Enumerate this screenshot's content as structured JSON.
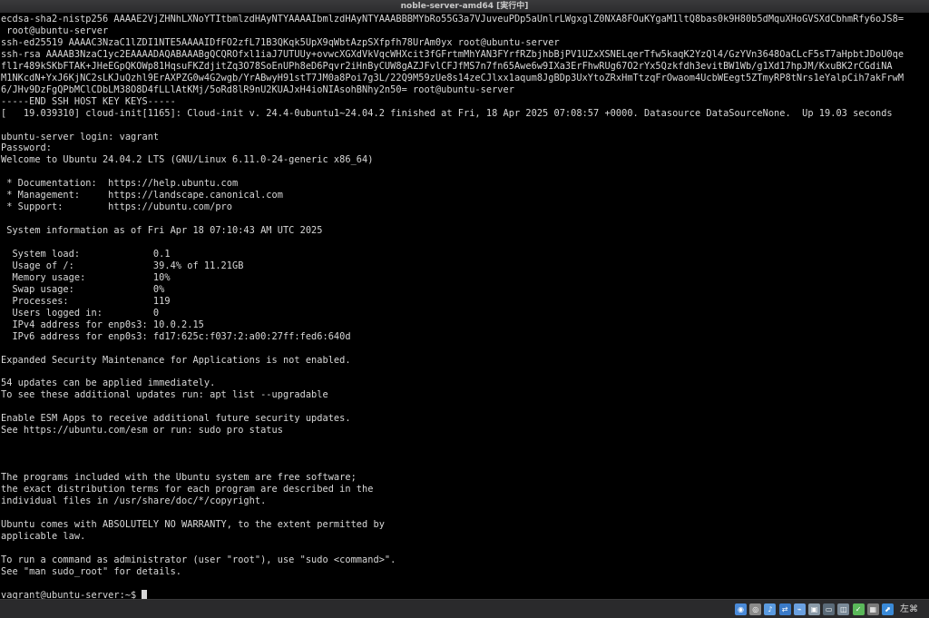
{
  "window": {
    "title": "noble-server-amd64 [実行中]"
  },
  "console": {
    "lines": [
      "ecdsa-sha2-nistp256 AAAAE2VjZHNhLXNoYTItbmlzdHAyNTYAAAAIbmlzdHAyNTYAAABBBMYbRo55G3a7VJuveuPDp5aUnlrLWgxglZ0NXA8FOuKYgaM1ltQ8bas0k9H80b5dMquXHoGVSXdCbhmRfy6oJS8=",
      " root@ubuntu-server",
      "ssh-ed25519 AAAAC3NzaC1lZDI1NTE5AAAAIDfFO2zfL71B3QKqk5UpX9qWbtAzpSXfpfh78UrAm0yx root@ubuntu-server",
      "ssh-rsa AAAAB3NzaC1yc2EAAAADAQABAAABgQCQROfxl1iaJ7UTUUy+ovwcXGXdVkVqcWHXcit3fGFrtmMhYAN3FYrfRZbjhbBjPV1UZxXSNELqerTfw5kaqK2YzQl4/GzYVn3648OaCLcF5sT7aHpbtJDoU0qe",
      "fl1r489kSKbFTAK+JHeEGpQKOWp81HqsuFKZdjitZq3O78SoEnUPh8eD6Pqvr2iHnByCUW8gAZJFvlCFJfMS7n7fn65Awe6w9IXa3ErFhwRUg67O2rYx5Qzkfdh3evitBW1Wb/g1Xd17hpJM/KxuBK2rCGdiNA",
      "M1NKcdN+YxJ6KjNC2sLKJuQzhl9ErAXPZG0w4G2wgb/YrABwyH91stT7JM0a8Poi7g3L/22Q9M59zUe8s14zeCJlxx1aqum8JgBDp3UxYtoZRxHmTtzqFrOwaom4UcbWEegt5ZTmyRP8tNrs1eYalpCih7akFrwM",
      "6/JHv9DzFgQPbMClCDbLM38O8D4fLLlAtKMj/5oRd8lR9nU2KUAJxH4ioNIAsohBNhy2n50= root@ubuntu-server",
      "-----END SSH HOST KEY KEYS-----",
      "[   19.039310] cloud-init[1165]: Cloud-init v. 24.4-0ubuntu1~24.04.2 finished at Fri, 18 Apr 2025 07:08:57 +0000. Datasource DataSourceNone.  Up 19.03 seconds",
      "",
      "ubuntu-server login: vagrant",
      "Password:",
      "Welcome to Ubuntu 24.04.2 LTS (GNU/Linux 6.11.0-24-generic x86_64)",
      "",
      " * Documentation:  https://help.ubuntu.com",
      " * Management:     https://landscape.canonical.com",
      " * Support:        https://ubuntu.com/pro",
      "",
      " System information as of Fri Apr 18 07:10:43 AM UTC 2025",
      "",
      "  System load:             0.1",
      "  Usage of /:              39.4% of 11.21GB",
      "  Memory usage:            10%",
      "  Swap usage:              0%",
      "  Processes:               119",
      "  Users logged in:         0",
      "  IPv4 address for enp0s3: 10.0.2.15",
      "  IPv6 address for enp0s3: fd17:625c:f037:2:a00:27ff:fed6:640d",
      "",
      "Expanded Security Maintenance for Applications is not enabled.",
      "",
      "54 updates can be applied immediately.",
      "To see these additional updates run: apt list --upgradable",
      "",
      "Enable ESM Apps to receive additional future security updates.",
      "See https://ubuntu.com/esm or run: sudo pro status",
      "",
      "",
      "",
      "The programs included with the Ubuntu system are free software;",
      "the exact distribution terms for each program are described in the",
      "individual files in /usr/share/doc/*/copyright.",
      "",
      "Ubuntu comes with ABSOLUTELY NO WARRANTY, to the extent permitted by",
      "applicable law.",
      "",
      "To run a command as administrator (user \"root\"), use \"sudo <command>\".",
      "See \"man sudo_root\" for details.",
      ""
    ],
    "prompt": "vagrant@ubuntu-server:~$ "
  },
  "statusbar": {
    "icons": [
      {
        "name": "hard-disk-icon",
        "color": "#4a8ad8"
      },
      {
        "name": "optical-drive-icon",
        "color": "#8a8a8a"
      },
      {
        "name": "audio-icon",
        "color": "#5a9ae0"
      },
      {
        "name": "network-icon",
        "color": "#3a7ac8"
      },
      {
        "name": "usb-icon",
        "color": "#6aa0e0"
      },
      {
        "name": "shared-folder-icon",
        "color": "#8a9aa8"
      },
      {
        "name": "display-icon",
        "color": "#5a6a78"
      },
      {
        "name": "video-capture-icon",
        "color": "#7a8a98"
      },
      {
        "name": "guest-additions-icon",
        "color": "#5ab85a"
      },
      {
        "name": "cpu-icon",
        "color": "#7a7a7a"
      },
      {
        "name": "mouse-integration-icon",
        "color": "#3a8ad8"
      }
    ],
    "host_key": "左⌘"
  }
}
